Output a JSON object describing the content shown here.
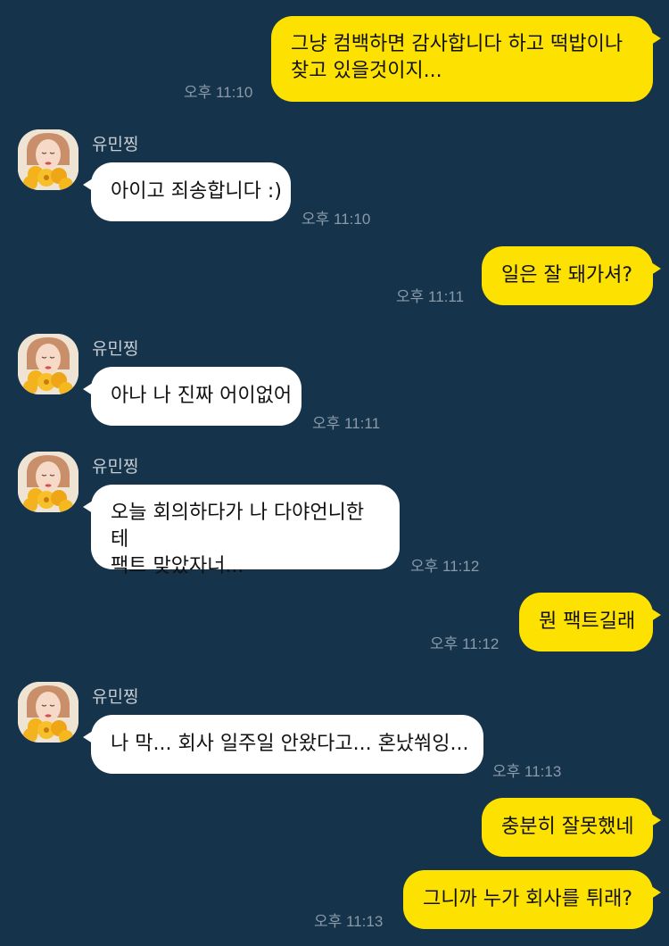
{
  "colors": {
    "background": "#15334a",
    "my_bubble": "#fde201",
    "their_bubble": "#ffffff",
    "time_text": "#8a9aa8",
    "sender_text": "#c7ccd1"
  },
  "messages": [
    {
      "kind": "mine",
      "text": "그냥 컴백하면 감사합니다 하고 떡밥이나\n찾고 있을것이지...",
      "time": "오후 11:10"
    },
    {
      "kind": "theirs",
      "sender": "유민찡",
      "avatar_icon": "profile-photo-icon",
      "text": "아이고 죄송합니다 :)",
      "time": "오후 11:10"
    },
    {
      "kind": "mine",
      "text": "일은 잘 돼가셔?",
      "time": "오후 11:11"
    },
    {
      "kind": "theirs",
      "sender": "유민찡",
      "avatar_icon": "profile-photo-icon",
      "text": "아나 나 진짜 어이없어",
      "time": "오후 11:11"
    },
    {
      "kind": "theirs",
      "sender": "유민찡",
      "avatar_icon": "profile-photo-icon",
      "text": "오늘 회의하다가 나 다야언니한테\n팩트 맞았자너...",
      "time": "오후 11:12"
    },
    {
      "kind": "mine",
      "text": "뭔 팩트길래",
      "time": "오후 11:12"
    },
    {
      "kind": "theirs",
      "sender": "유민찡",
      "avatar_icon": "profile-photo-icon",
      "text": "나 막... 회사 일주일 안왔다고... 혼났쒀잉...",
      "time": "오후 11:13"
    },
    {
      "kind": "mine",
      "text": "충분히 잘못했네",
      "time": ""
    },
    {
      "kind": "mine",
      "text": "그니까 누가 회사를 튀래?",
      "time": "오후 11:13"
    }
  ]
}
